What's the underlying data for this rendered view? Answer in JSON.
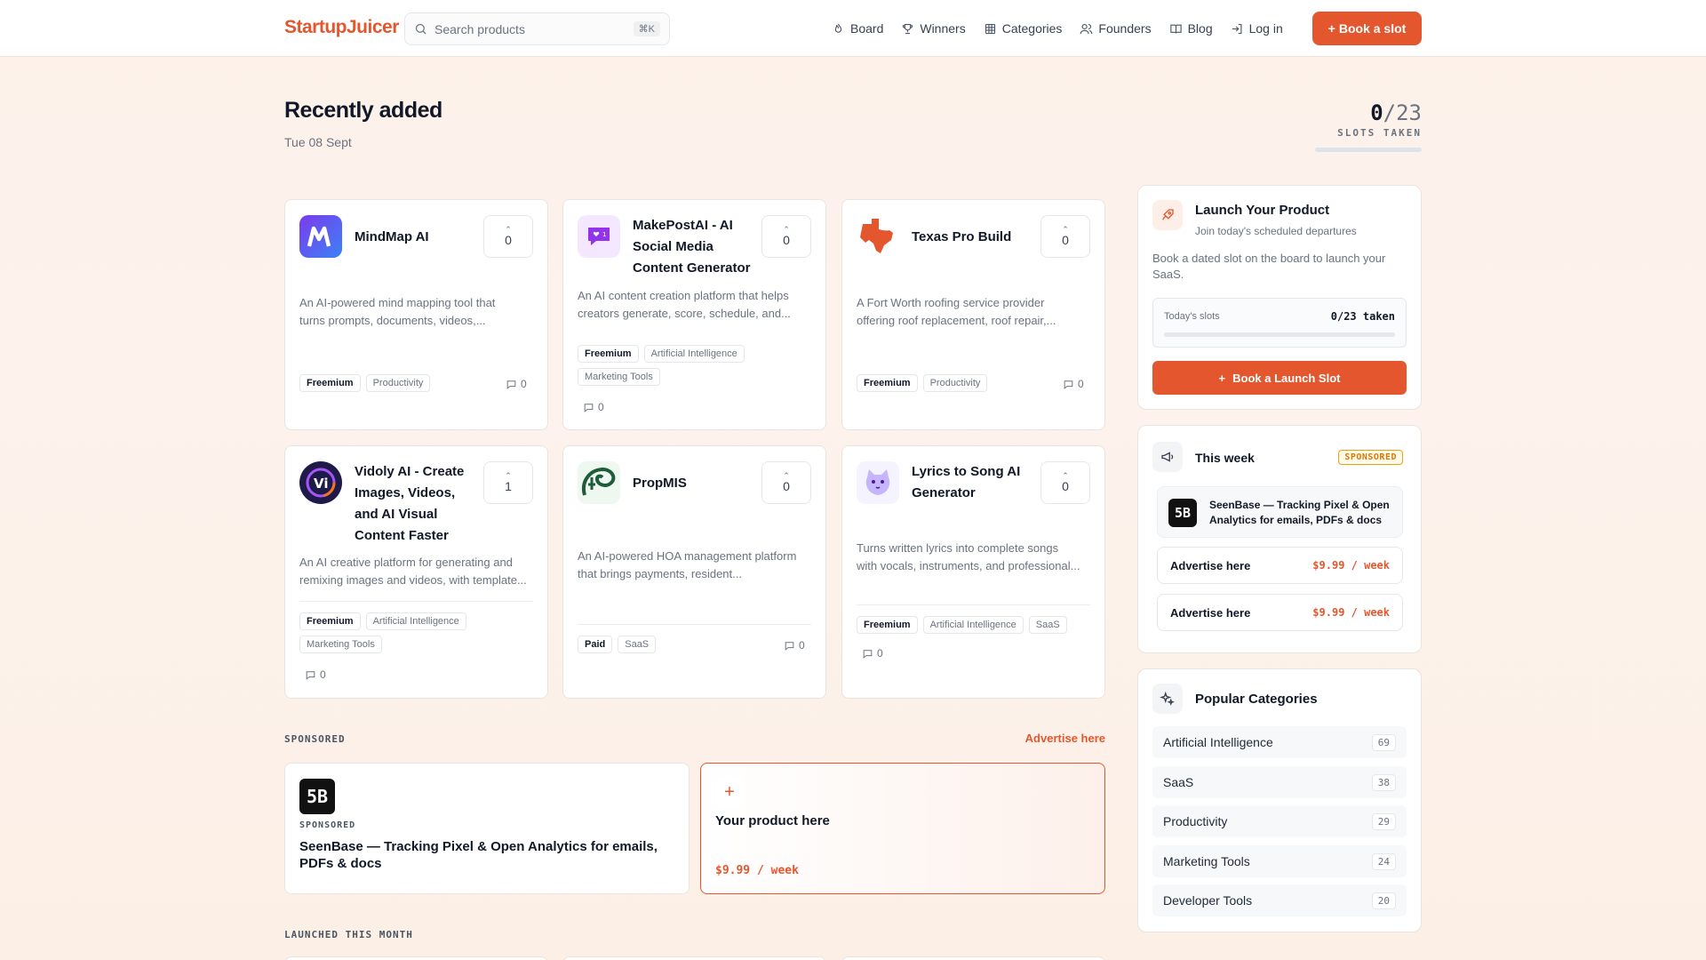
{
  "header": {
    "logo": "StartupJuicer",
    "search_placeholder": "Search products",
    "search_shortcut": "⌘K",
    "nav": [
      "Board",
      "Winners",
      "Categories",
      "Founders",
      "Blog",
      "Log in"
    ],
    "book_button": "Book a slot"
  },
  "heading": {
    "title": "Recently added",
    "date": "Tue 08 Sept",
    "slots_taken": "0",
    "slots_total": "/23",
    "slots_label": "SLOTS TAKEN"
  },
  "products": [
    {
      "name": "MindMap AI",
      "votes": "0",
      "desc1": "An AI-powered mind mapping tool that",
      "desc2": "turns prompts, documents, videos,...",
      "tags": [
        "Freemium",
        "Productivity"
      ],
      "comments": "0",
      "icon": "mindmap-logo"
    },
    {
      "name": "MakePostAI - AI Social Media Content Generator",
      "votes": "0",
      "desc1": "An AI content creation platform that helps",
      "desc2": "creators generate, score, schedule, and...",
      "tags": [
        "Freemium",
        "Artificial Intelligence",
        "Marketing Tools"
      ],
      "comments": "0",
      "icon": "makepost-logo"
    },
    {
      "name": "Texas Pro Build",
      "votes": "0",
      "desc1": "A Fort Worth roofing service provider",
      "desc2": "offering roof replacement, roof repair,...",
      "tags": [
        "Freemium",
        "Productivity"
      ],
      "comments": "0",
      "icon": "texas-logo"
    },
    {
      "name": "Vidoly AI - Create Images, Videos, and AI Visual Content Faster",
      "votes": "1",
      "desc1": "An AI creative platform for generating and",
      "desc2": "remixing images and videos, with template...",
      "tags": [
        "Freemium",
        "Artificial Intelligence",
        "Marketing Tools"
      ],
      "comments": "0",
      "icon": "vidoly-logo"
    },
    {
      "name": "PropMIS",
      "votes": "0",
      "desc1": "An AI-powered HOA management platform",
      "desc2": "that brings payments, resident...",
      "tags": [
        "Paid",
        "SaaS"
      ],
      "comments": "0",
      "icon": "propmis-logo"
    },
    {
      "name": "Lyrics to Song AI Generator",
      "votes": "0",
      "desc1": "Turns written lyrics into complete songs",
      "desc2": "with vocals, instruments, and professional...",
      "tags": [
        "Freemium",
        "Artificial Intelligence",
        "SaaS"
      ],
      "comments": "0",
      "icon": "lyrics-logo"
    }
  ],
  "sponsored": {
    "section_label": "SPONSORED",
    "advertise_link": "Advertise here",
    "logo_text": "5B",
    "badge": "SPONSORED",
    "sponsor_title1": "SeenBase — Tracking Pixel & Open Analytics for emails,",
    "sponsor_title2": "PDFs & docs",
    "your_product": "Your product here",
    "price": "$9.99 / week"
  },
  "launched_label": "LAUNCHED THIS MONTH",
  "sidebar": {
    "launch": {
      "title": "Launch Your Product",
      "subtitle": "Join today's scheduled departures",
      "desc1": "Book a dated slot on the board to launch your",
      "desc2": "SaaS.",
      "todays_slots": "Today's slots",
      "taken": "0/23 taken",
      "button": "Book a Launch Slot"
    },
    "week": {
      "title": "This week",
      "badge": "SPONSORED",
      "sponsor_line1": "SeenBase — Tracking Pixel & Open",
      "sponsor_line2": "Analytics for emails, PDFs & docs",
      "advertise": "Advertise here",
      "price": "$9.99 / week"
    },
    "categories": {
      "title": "Popular Categories",
      "items": [
        {
          "name": "Artificial Intelligence",
          "count": "69"
        },
        {
          "name": "SaaS",
          "count": "38"
        },
        {
          "name": "Productivity",
          "count": "29"
        },
        {
          "name": "Marketing Tools",
          "count": "24"
        },
        {
          "name": "Developer Tools",
          "count": "20"
        }
      ]
    }
  },
  "colors": {
    "accent": "#e4572e",
    "background": "#fdf1ea"
  }
}
